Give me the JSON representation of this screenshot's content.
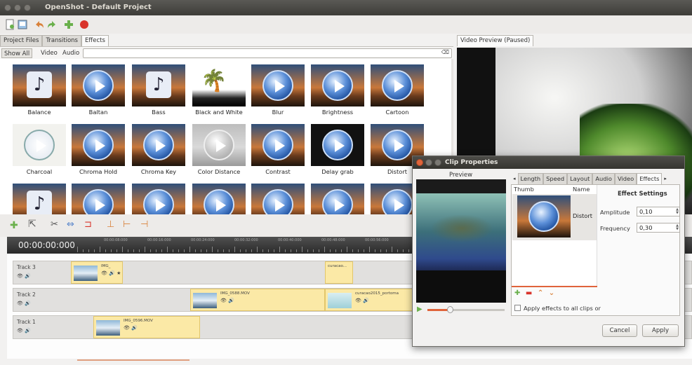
{
  "window": {
    "title": "OpenShot - Default Project"
  },
  "left_tabs": [
    "Project Files",
    "Transitions",
    "Effects"
  ],
  "filters": {
    "show_all": "Show All",
    "video": "Video",
    "audio": "Audio"
  },
  "effects": [
    {
      "label": "Balance",
      "thumb": "note"
    },
    {
      "label": "Baltan",
      "thumb": "ball"
    },
    {
      "label": "Bass",
      "thumb": "note"
    },
    {
      "label": "Black and White",
      "thumb": "bw"
    },
    {
      "label": "Blur",
      "thumb": "ball"
    },
    {
      "label": "Brightness",
      "thumb": "ball"
    },
    {
      "label": "Cartoon",
      "thumb": "ball"
    },
    {
      "label": "Charcoal",
      "thumb": "sketch"
    },
    {
      "label": "Chroma Hold",
      "thumb": "ball"
    },
    {
      "label": "Chroma Key",
      "thumb": "ball"
    },
    {
      "label": "Color Distance",
      "thumb": "grey"
    },
    {
      "label": "Contrast",
      "thumb": "ball"
    },
    {
      "label": "Delay grab",
      "thumb": "dark"
    },
    {
      "label": "Distort",
      "thumb": "ball"
    },
    {
      "label": "",
      "thumb": "note"
    },
    {
      "label": "",
      "thumb": "ball"
    },
    {
      "label": "",
      "thumb": "ball"
    },
    {
      "label": "",
      "thumb": "ball"
    },
    {
      "label": "",
      "thumb": "ball"
    },
    {
      "label": "",
      "thumb": "ball"
    },
    {
      "label": "",
      "thumb": "ball"
    }
  ],
  "preview": {
    "tab": "Video Preview (Paused)"
  },
  "timeline": {
    "timecode": "00:00:00:000",
    "ruler_labels": [
      "00:00:08:000",
      "00:00:16:000",
      "00:00:24:000",
      "00:00:32:000",
      "00:00:40:000",
      "00:00:48:000",
      "00:00:56:000"
    ],
    "tracks": [
      {
        "name": "Track 3",
        "clips": [
          {
            "name": "IMG_",
            "star": true
          },
          {
            "name": "curacao...",
            "star": false
          }
        ]
      },
      {
        "name": "Track 2",
        "clips": [
          {
            "name": "IMG_0588.MOV",
            "star": false
          },
          {
            "name": "curacao2015_portoma",
            "star": false
          }
        ]
      },
      {
        "name": "Track 1",
        "clips": [
          {
            "name": "IMG_0596.MOV",
            "star": false
          }
        ]
      }
    ]
  },
  "dialog": {
    "title": "Clip Properties",
    "preview_label": "Preview",
    "tabs": [
      "Length",
      "Speed",
      "Layout",
      "Audio",
      "Video",
      "Effects"
    ],
    "list_headers": {
      "thumb": "Thumb",
      "name": "Name"
    },
    "effect_row": {
      "name": "Distort"
    },
    "settings_title": "Effect Settings",
    "amplitude": {
      "label": "Amplitude",
      "value": "0,10"
    },
    "frequency": {
      "label": "Frequency",
      "value": "0,30"
    },
    "apply_all": "Apply effects to all clips or",
    "cancel": "Cancel",
    "apply": "Apply"
  }
}
